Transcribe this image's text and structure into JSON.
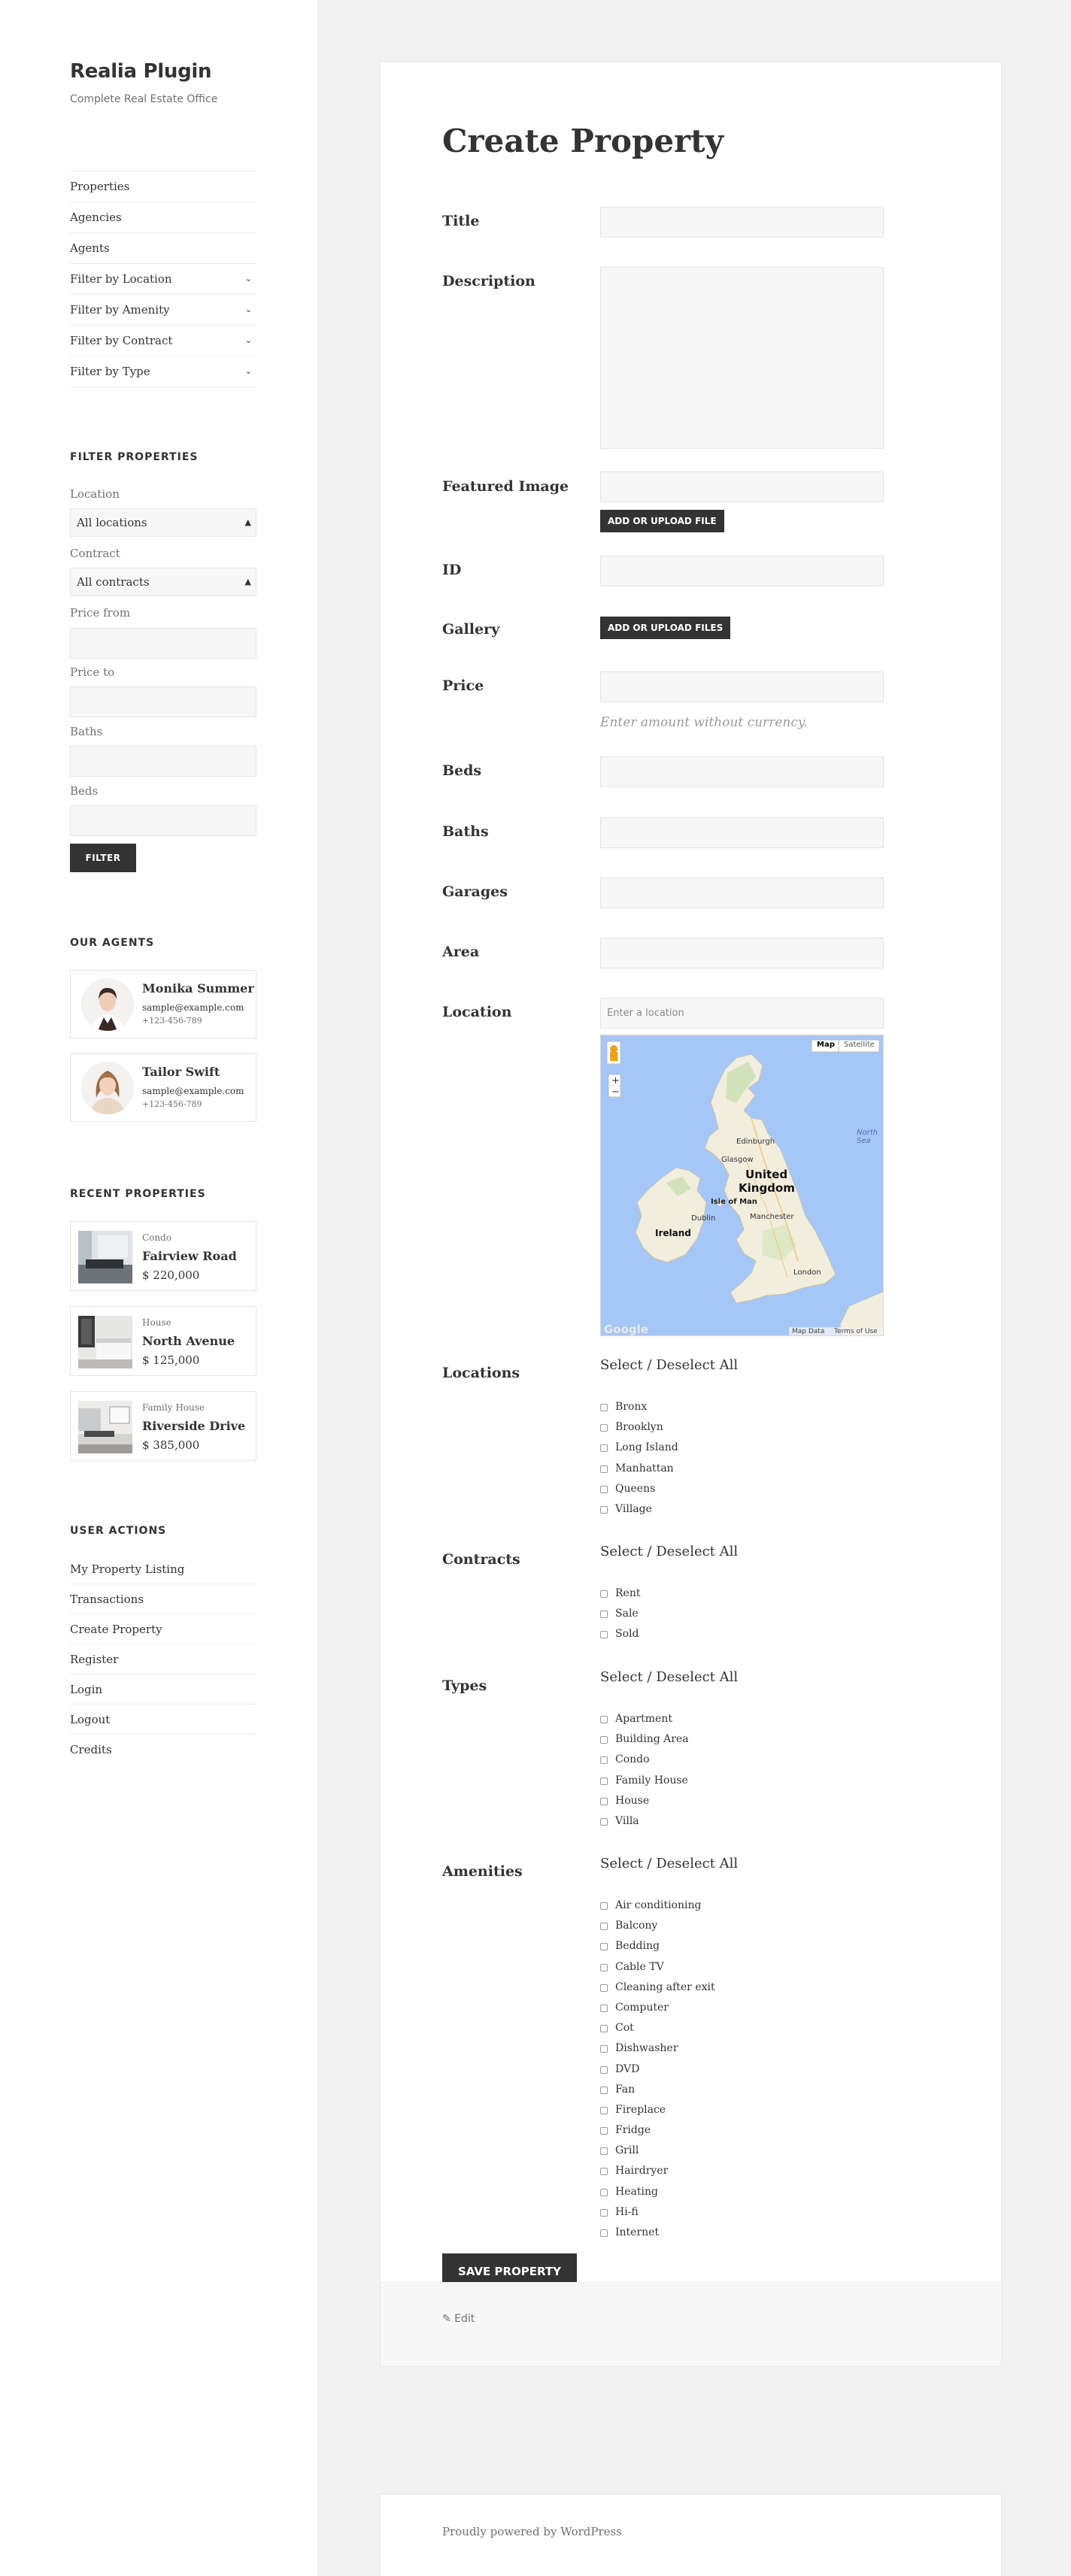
{
  "site": {
    "title": "Realia Plugin",
    "description": "Complete Real Estate Office"
  },
  "nav": [
    {
      "label": "Properties",
      "has_children": false
    },
    {
      "label": "Agencies",
      "has_children": false
    },
    {
      "label": "Agents",
      "has_children": false
    },
    {
      "label": "Filter by Location",
      "has_children": true
    },
    {
      "label": "Filter by Amenity",
      "has_children": true
    },
    {
      "label": "Filter by Contract",
      "has_children": true
    },
    {
      "label": "Filter by Type",
      "has_children": true
    }
  ],
  "filter": {
    "title": "FILTER PROPERTIES",
    "location_label": "Location",
    "location_value": "All locations",
    "contract_label": "Contract",
    "contract_value": "All contracts",
    "price_from_label": "Price from",
    "price_to_label": "Price to",
    "baths_label": "Baths",
    "beds_label": "Beds",
    "button": "FILTER"
  },
  "agents": {
    "title": "OUR AGENTS",
    "items": [
      {
        "name": "Monika Summer",
        "email": "sample@example.com",
        "phone": "+123-456-789"
      },
      {
        "name": "Tailor Swift",
        "email": "sample@example.com",
        "phone": "+123-456-789"
      }
    ]
  },
  "recent": {
    "title": "RECENT PROPERTIES",
    "items": [
      {
        "type": "Condo",
        "name": "Fairview Road",
        "price": "$ 220,000"
      },
      {
        "type": "House",
        "name": "North Avenue",
        "price": "$ 125,000"
      },
      {
        "type": "Family House",
        "name": "Riverside Drive",
        "price": "$ 385,000"
      }
    ]
  },
  "user_actions": {
    "title": "USER ACTIONS",
    "items": [
      "My Property Listing",
      "Transactions",
      "Create Property",
      "Register",
      "Login",
      "Logout",
      "Credits"
    ]
  },
  "form": {
    "page_title": "Create Property",
    "title_label": "Title",
    "description_label": "Description",
    "featured_label": "Featured Image",
    "upload_file": "ADD OR UPLOAD FILE",
    "id_label": "ID",
    "gallery_label": "Gallery",
    "upload_files": "ADD OR UPLOAD FILES",
    "price_label": "Price",
    "price_hint": "Enter amount without currency.",
    "beds_label": "Beds",
    "baths_label": "Baths",
    "garages_label": "Garages",
    "area_label": "Area",
    "location_label": "Location",
    "location_placeholder": "Enter a location",
    "map": {
      "map_btn": "Map",
      "satellite_btn": "Satellite",
      "labels": [
        "Edinburgh",
        "Glasgow",
        "United",
        "Kingdom",
        "Isle of Man",
        "Dublin",
        "Ireland",
        "Manchester",
        "London",
        "North Sea"
      ],
      "google": "Google",
      "map_data": "Map Data",
      "terms": "Terms of Use",
      "zoom_in": "+",
      "zoom_out": "−"
    },
    "select_all": "Select / Deselect All",
    "locations_label": "Locations",
    "locations": [
      "Bronx",
      "Brooklyn",
      "Long Island",
      "Manhattan",
      "Queens",
      "Village"
    ],
    "contracts_label": "Contracts",
    "contracts": [
      "Rent",
      "Sale",
      "Sold"
    ],
    "types_label": "Types",
    "types": [
      "Apartment",
      "Building Area",
      "Condo",
      "Family House",
      "House",
      "Villa"
    ],
    "amenities_label": "Amenities",
    "amenities": [
      "Air conditioning",
      "Balcony",
      "Bedding",
      "Cable TV",
      "Cleaning after exit",
      "Computer",
      "Cot",
      "Dishwasher",
      "DVD",
      "Fan",
      "Fireplace",
      "Fridge",
      "Grill",
      "Hairdryer",
      "Heating",
      "Hi-fi",
      "Internet"
    ],
    "save_button": "SAVE PROPERTY"
  },
  "edit_link": "✎ Edit",
  "footer": "Proudly powered by WordPress"
}
